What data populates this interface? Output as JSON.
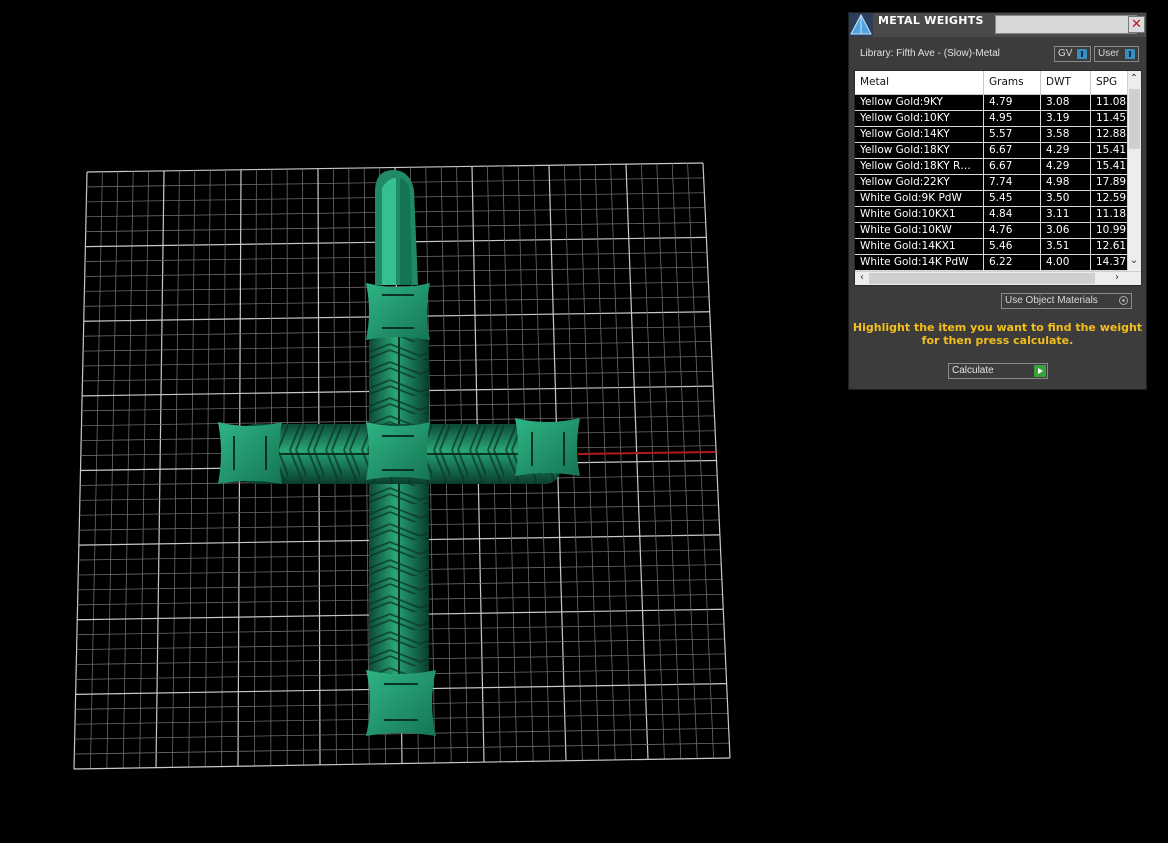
{
  "window": {
    "title": "METAL WEIGHTS",
    "close_glyph": "✕",
    "library_label": "Library: Fifth Ave - (Slow)-Metal",
    "toggle_gv": "GV",
    "toggle_user": "User"
  },
  "table": {
    "columns": [
      "Metal",
      "Grams",
      "DWT",
      "SPG"
    ],
    "rows": [
      {
        "metal": "Yellow Gold:9KY",
        "grams": "4.79",
        "dwt": "3.08",
        "spg": "11.08"
      },
      {
        "metal": "Yellow Gold:10KY",
        "grams": "4.95",
        "dwt": "3.19",
        "spg": "11.45"
      },
      {
        "metal": "Yellow Gold:14KY",
        "grams": "5.57",
        "dwt": "3.58",
        "spg": "12.88"
      },
      {
        "metal": "Yellow Gold:18KY",
        "grams": "6.67",
        "dwt": "4.29",
        "spg": "15.41"
      },
      {
        "metal": "Yellow Gold:18KY R…",
        "grams": "6.67",
        "dwt": "4.29",
        "spg": "15.41"
      },
      {
        "metal": "Yellow Gold:22KY",
        "grams": "7.74",
        "dwt": "4.98",
        "spg": "17.89"
      },
      {
        "metal": "White Gold:9K PdW",
        "grams": "5.45",
        "dwt": "3.50",
        "spg": "12.59"
      },
      {
        "metal": "White Gold:10KX1",
        "grams": "4.84",
        "dwt": "3.11",
        "spg": "11.18"
      },
      {
        "metal": "White Gold:10KW",
        "grams": "4.76",
        "dwt": "3.06",
        "spg": "10.99"
      },
      {
        "metal": "White Gold:14KX1",
        "grams": "5.46",
        "dwt": "3.51",
        "spg": "12.61"
      },
      {
        "metal": "White Gold:14K PdW",
        "grams": "6.22",
        "dwt": "4.00",
        "spg": "14.37"
      }
    ]
  },
  "use_object_materials_label": "Use Object Materials",
  "hint_line1": "Highlight the item you want to find the weight",
  "hint_line2": "for then press calculate.",
  "calculate_label": "Calculate",
  "icons": [
    "app-logo-icon",
    "close-icon",
    "scroll-up-arrow-icon",
    "scroll-down-arrow-icon",
    "scroll-left-arrow-icon",
    "scroll-right-arrow-icon",
    "go-arrow-icon",
    "radio-icon"
  ],
  "colors": {
    "model": "#1f8a64",
    "panel": "#3c3c3c",
    "hint": "#f4bf1c",
    "grid": "#c8c8c8",
    "axis": "#b01a1a",
    "accent": "#3a8fc2"
  }
}
